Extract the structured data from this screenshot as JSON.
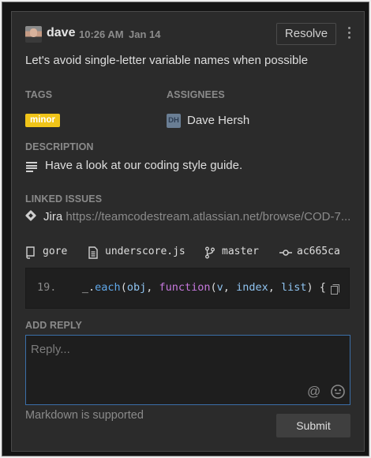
{
  "header": {
    "author": "dave",
    "time": "10:26 AM",
    "date": "Jan 14",
    "resolve_label": "Resolve",
    "avatar_icon": "user-photo"
  },
  "comment_text": "Let's avoid single-letter variable names when possible",
  "tags": {
    "label": "TAGS",
    "items": [
      {
        "text": "minor",
        "color": "#f0c419"
      }
    ]
  },
  "assignees": {
    "label": "ASSIGNEES",
    "items": [
      {
        "initials": "DH",
        "name": "Dave Hersh"
      }
    ]
  },
  "description": {
    "label": "DESCRIPTION",
    "text": "Have a look at our coding style guide.",
    "icon": "text-lines-icon"
  },
  "linked_issues": {
    "label": "LINKED ISSUES",
    "provider": "Jira",
    "url": "https://teamcodestream.atlassian.net/browse/COD-7..."
  },
  "code_context": {
    "repo": "gore",
    "file": "underscore.js",
    "branch": "master",
    "commit": "ac665ca",
    "line_number": "19.",
    "code": {
      "underscore": "_.",
      "fn": "each",
      "open": "(",
      "arg1": "obj",
      "comma1": ", ",
      "kw": "function",
      "open2": "(",
      "p1": "v",
      "comma2": ", ",
      "p2": "index",
      "comma3": ", ",
      "p3": "list",
      "close": ") {"
    }
  },
  "reply": {
    "label": "ADD REPLY",
    "placeholder": "Reply...",
    "markdown_note": "Markdown is supported",
    "submit_label": "Submit"
  },
  "colors": {
    "panel_bg": "#2b2b2b",
    "accent_focus": "#3b6fa8",
    "tag_minor": "#f0c419"
  }
}
